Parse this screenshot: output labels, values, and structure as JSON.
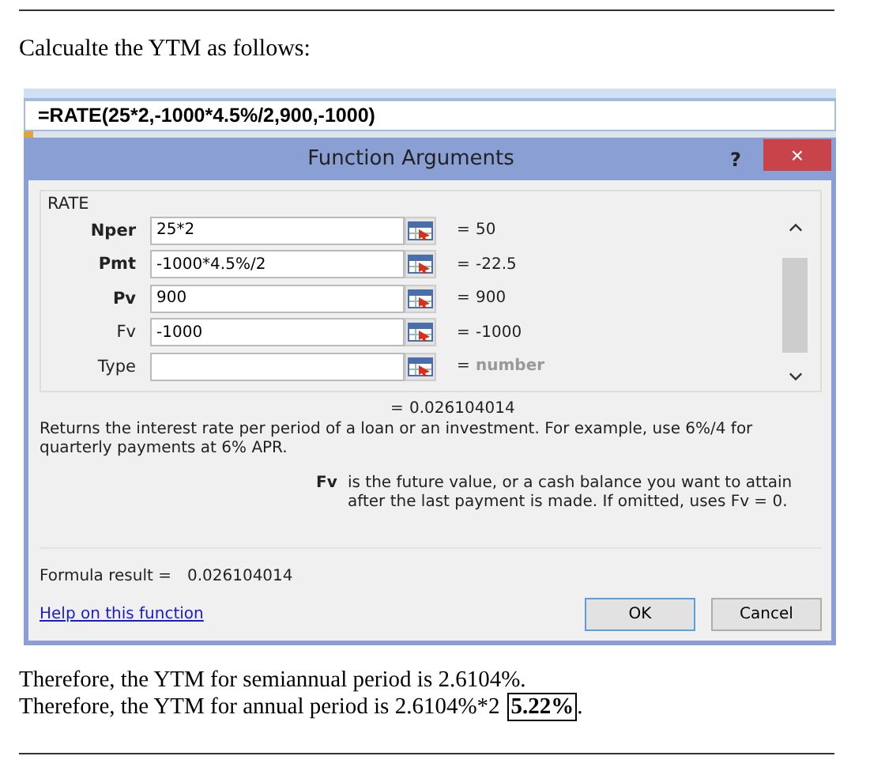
{
  "intro": "Calcualte the YTM as follows:",
  "formula_bar": "=RATE(25*2,-1000*4.5%/2,900,-1000)",
  "dialog": {
    "title": "Function Arguments",
    "help": "?",
    "close": "×",
    "function_name": "RATE",
    "arguments": [
      {
        "label": "Nper",
        "required": true,
        "value": "25*2",
        "result": "50",
        "muted": false
      },
      {
        "label": "Pmt",
        "required": true,
        "value": "-1000*4.5%/2",
        "result": "-22.5",
        "muted": false
      },
      {
        "label": "Pv",
        "required": true,
        "value": "900",
        "result": "900",
        "muted": false
      },
      {
        "label": "Fv",
        "required": false,
        "value": "-1000",
        "result": "-1000",
        "muted": false
      },
      {
        "label": "Type",
        "required": false,
        "result": "number",
        "muted": true
      }
    ],
    "equals": "=",
    "overall_result": "0.026104014",
    "description": "Returns the interest rate per period of a loan or an investment. For example, use 6%/4 for quarterly payments at 6% APR.",
    "argument_help": {
      "name": "Fv",
      "text": "is the future value, or a cash balance you want to attain after the last payment is made. If omitted, uses Fv = 0."
    },
    "formula_result_label": "Formula result =",
    "formula_result": "0.026104014",
    "help_link": "Help on this function",
    "buttons": [
      {
        "label": "OK",
        "default": true
      },
      {
        "label": "Cancel",
        "default": false
      }
    ]
  },
  "conclusions": [
    {
      "text": "Therefore, the YTM  for semiannual period is 2.6104%."
    },
    {
      "text": "Therefore, the YTM  for annual period is 2.6104%*2",
      "boxed": "5.22%",
      "tail": "."
    }
  ]
}
